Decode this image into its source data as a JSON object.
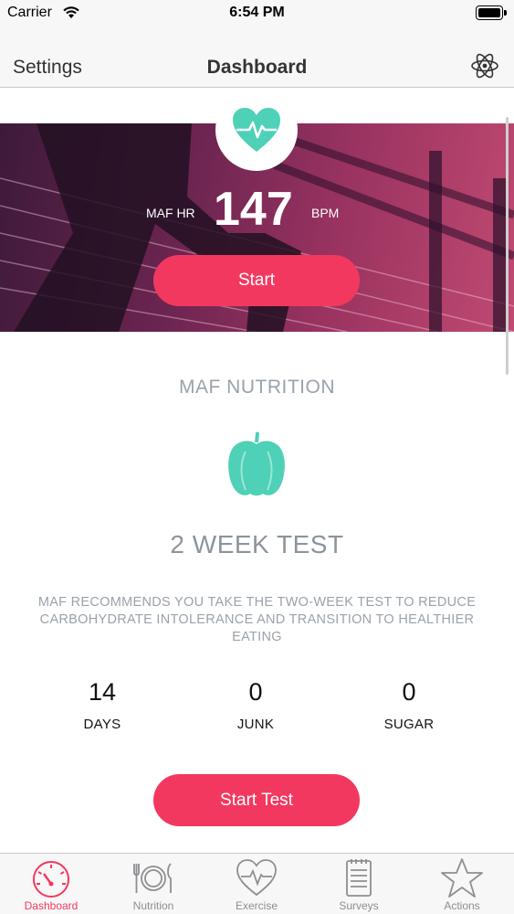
{
  "status_bar": {
    "carrier": "Carrier",
    "time": "6:54 PM"
  },
  "nav": {
    "left_label": "Settings",
    "title": "Dashboard",
    "right_icon": "atom-icon"
  },
  "hero": {
    "icon": "heart-rate-icon",
    "label": "MAF HR",
    "value": "147",
    "unit": "BPM",
    "button_label": "Start"
  },
  "nutrition": {
    "section_title": "MAF NUTRITION",
    "icon": "pepper-icon",
    "test_title": "2 WEEK TEST",
    "description": "MAF RECOMMENDS YOU TAKE THE TWO-WEEK TEST TO REDUCE CARBOHYDRATE INTOLERANCE AND TRANSITION TO HEALTHIER EATING",
    "stats": [
      {
        "value": "14",
        "label": "DAYS"
      },
      {
        "value": "0",
        "label": "JUNK"
      },
      {
        "value": "0",
        "label": "SUGAR"
      }
    ],
    "button_label": "Start Test"
  },
  "tabs": [
    {
      "label": "Dashboard",
      "icon": "gauge-icon",
      "active": true
    },
    {
      "label": "Nutrition",
      "icon": "plate-icon",
      "active": false
    },
    {
      "label": "Exercise",
      "icon": "heart-pulse-icon",
      "active": false
    },
    {
      "label": "Surveys",
      "icon": "notepad-icon",
      "active": false
    },
    {
      "label": "Actions",
      "icon": "star-icon",
      "active": false
    }
  ],
  "colors": {
    "accent": "#f3385f",
    "teal": "#4ed1b6",
    "muted_text": "#9aa2aa"
  }
}
